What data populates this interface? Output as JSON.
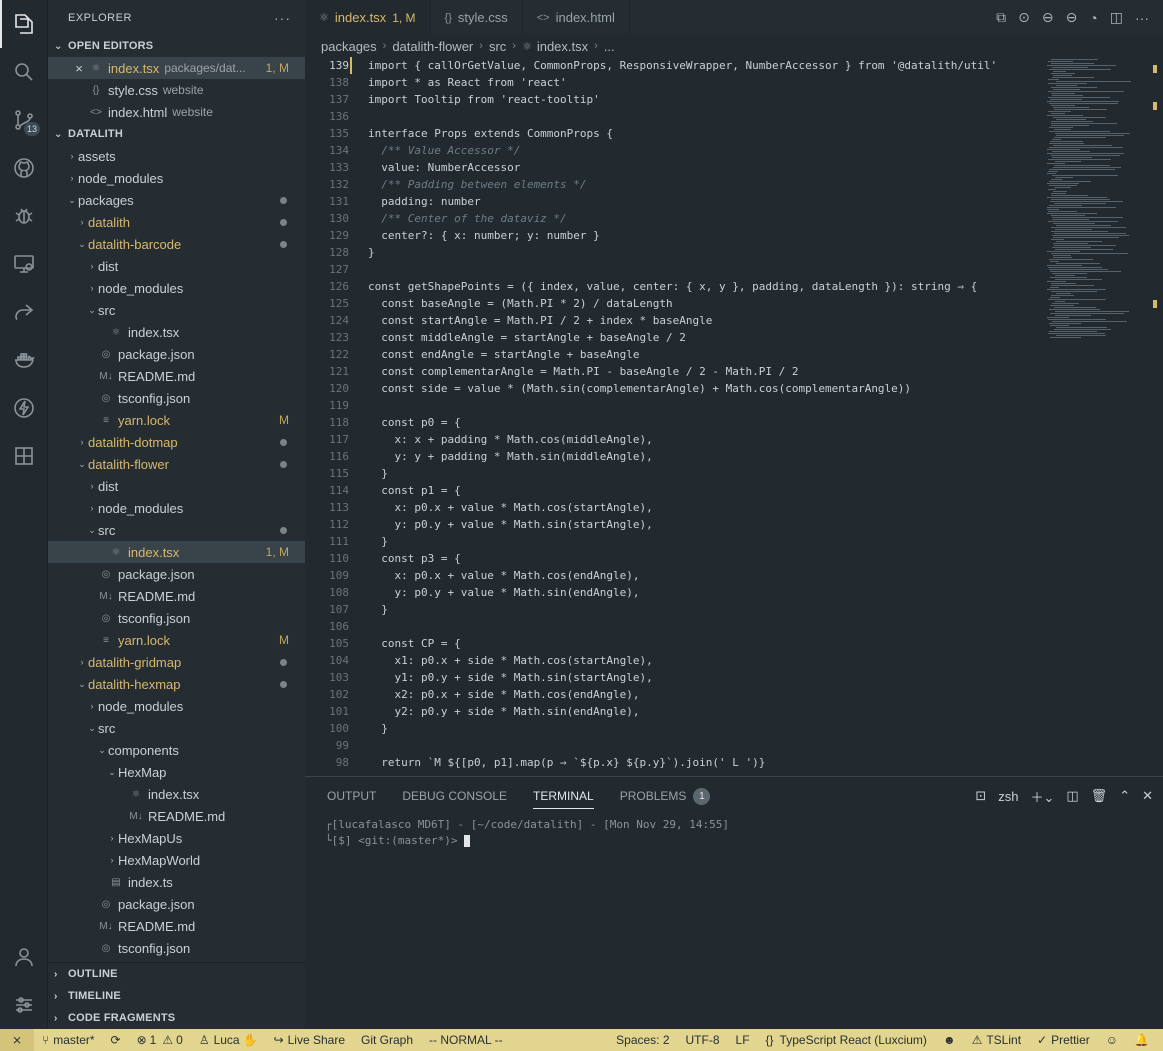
{
  "activity_bar": {
    "source_control_badge": "13"
  },
  "sidebar": {
    "title": "EXPLORER",
    "more": "···",
    "open_editors": {
      "label": "OPEN EDITORS",
      "items": [
        {
          "name": "index.tsx",
          "desc": "packages/dat...",
          "deco": "1, M",
          "icon": "react-icon"
        },
        {
          "name": "style.css",
          "desc": "website",
          "icon": "css-icon"
        },
        {
          "name": "index.html",
          "desc": "website",
          "icon": "html-icon"
        }
      ]
    },
    "workspace": {
      "label": "DATALITH",
      "tree": [
        {
          "label": "assets"
        },
        {
          "label": "node_modules"
        },
        {
          "label": "packages"
        },
        {
          "label": "datalith"
        },
        {
          "label": "datalith-barcode"
        },
        {
          "label": "dist"
        },
        {
          "label": "node_modules"
        },
        {
          "label": "src"
        },
        {
          "label": "index.tsx"
        },
        {
          "label": "package.json"
        },
        {
          "label": "README.md"
        },
        {
          "label": "tsconfig.json"
        },
        {
          "label": "yarn.lock",
          "deco": "M"
        },
        {
          "label": "datalith-dotmap"
        },
        {
          "label": "datalith-flower"
        },
        {
          "label": "dist"
        },
        {
          "label": "node_modules"
        },
        {
          "label": "src"
        },
        {
          "label": "index.tsx",
          "deco": "1, M"
        },
        {
          "label": "package.json"
        },
        {
          "label": "README.md"
        },
        {
          "label": "tsconfig.json"
        },
        {
          "label": "yarn.lock",
          "deco": "M"
        },
        {
          "label": "datalith-gridmap"
        },
        {
          "label": "datalith-hexmap"
        },
        {
          "label": "node_modules"
        },
        {
          "label": "src"
        },
        {
          "label": "components"
        },
        {
          "label": "HexMap"
        },
        {
          "label": "index.tsx"
        },
        {
          "label": "README.md"
        },
        {
          "label": "HexMapUs"
        },
        {
          "label": "HexMapWorld"
        },
        {
          "label": "index.ts"
        },
        {
          "label": "package.json"
        },
        {
          "label": "README.md"
        },
        {
          "label": "tsconfig.json"
        }
      ]
    },
    "bottom_sections": [
      "OUTLINE",
      "TIMELINE",
      "CODE FRAGMENTS"
    ]
  },
  "tabs": [
    {
      "label": "index.tsx",
      "deco": "1, M",
      "icon": "react-icon",
      "active": true
    },
    {
      "label": "style.css",
      "icon": "css-icon",
      "active": false
    },
    {
      "label": "index.html",
      "icon": "html-icon",
      "active": false
    }
  ],
  "breadcrumb": [
    "packages",
    "datalith-flower",
    "src",
    "index.tsx",
    "..."
  ],
  "editor": {
    "line_numbers": [
      "139",
      "138",
      "137",
      "136",
      "135",
      "134",
      "133",
      "132",
      "131",
      "130",
      "129",
      "128",
      "127",
      "126",
      "125",
      "124",
      "123",
      "122",
      "121",
      "120",
      "119",
      "118",
      "117",
      "116",
      "115",
      "114",
      "113",
      "112",
      "111",
      "110",
      "109",
      "108",
      "107",
      "106",
      "105",
      "104",
      "103",
      "102",
      "101",
      "100",
      "99",
      "98"
    ],
    "lines": [
      "import { callOrGetValue, CommonProps, ResponsiveWrapper, NumberAccessor } from '@datalith/util'",
      "import * as React from 'react'",
      "import Tooltip from 'react-tooltip'",
      "",
      "interface Props extends CommonProps {",
      "  /** Value Accessor */",
      "  value: NumberAccessor",
      "  /** Padding between elements */",
      "  padding: number",
      "  /** Center of the dataviz */",
      "  center?: { x: number; y: number }",
      "}",
      "",
      "const getShapePoints = ({ index, value, center: { x, y }, padding, dataLength }): string ⇒ {",
      "  const baseAngle = (Math.PI * 2) / dataLength",
      "  const startAngle = Math.PI / 2 + index * baseAngle",
      "  const middleAngle = startAngle + baseAngle / 2",
      "  const endAngle = startAngle + baseAngle",
      "  const complementarAngle = Math.PI - baseAngle / 2 - Math.PI / 2",
      "  const side = value * (Math.sin(complementarAngle) + Math.cos(complementarAngle))",
      "",
      "  const p0 = {",
      "    x: x + padding * Math.cos(middleAngle),",
      "    y: y + padding * Math.sin(middleAngle),",
      "  }",
      "  const p1 = {",
      "    x: p0.x + value * Math.cos(startAngle),",
      "    y: p0.y + value * Math.sin(startAngle),",
      "  }",
      "  const p3 = {",
      "    x: p0.x + value * Math.cos(endAngle),",
      "    y: p0.y + value * Math.sin(endAngle),",
      "  }",
      "",
      "  const CP = {",
      "    x1: p0.x + side * Math.cos(startAngle),",
      "    y1: p0.y + side * Math.sin(startAngle),",
      "    x2: p0.x + side * Math.cos(endAngle),",
      "    y2: p0.y + side * Math.sin(endAngle),",
      "  }",
      "",
      "  return `M ${[p0, p1].map(p ⇒ `${p.x} ${p.y}`).join(' L ')}"
    ]
  },
  "panel": {
    "tabs": [
      {
        "label": "OUTPUT"
      },
      {
        "label": "DEBUG CONSOLE"
      },
      {
        "label": "TERMINAL",
        "active": true
      },
      {
        "label": "PROBLEMS",
        "badge": "1"
      }
    ],
    "shell": "zsh",
    "terminal_lines": [
      "┌[lucafalasco MD6T] - [~/code/datalith] - [Mon Nov 29, 14:55]",
      "└[$] <git:(master*)> "
    ]
  },
  "status_bar": {
    "remote": "⨯",
    "branch": "master*",
    "errors": "1",
    "warnings": "0",
    "user": "Luca",
    "live_share": "Live Share",
    "git_graph": "Git Graph",
    "mode": "-- NORMAL --",
    "spaces": "Spaces: 2",
    "encoding": "UTF-8",
    "eol": "LF",
    "language": "TypeScript React (Luxcium)",
    "tslint": "TSLint",
    "prettier": "Prettier"
  },
  "colors": {
    "status_bar_bg": "#e2d58f",
    "editor_bg": "#22292f",
    "sidebar_bg": "#252d33",
    "modified": "#d7b96a"
  }
}
